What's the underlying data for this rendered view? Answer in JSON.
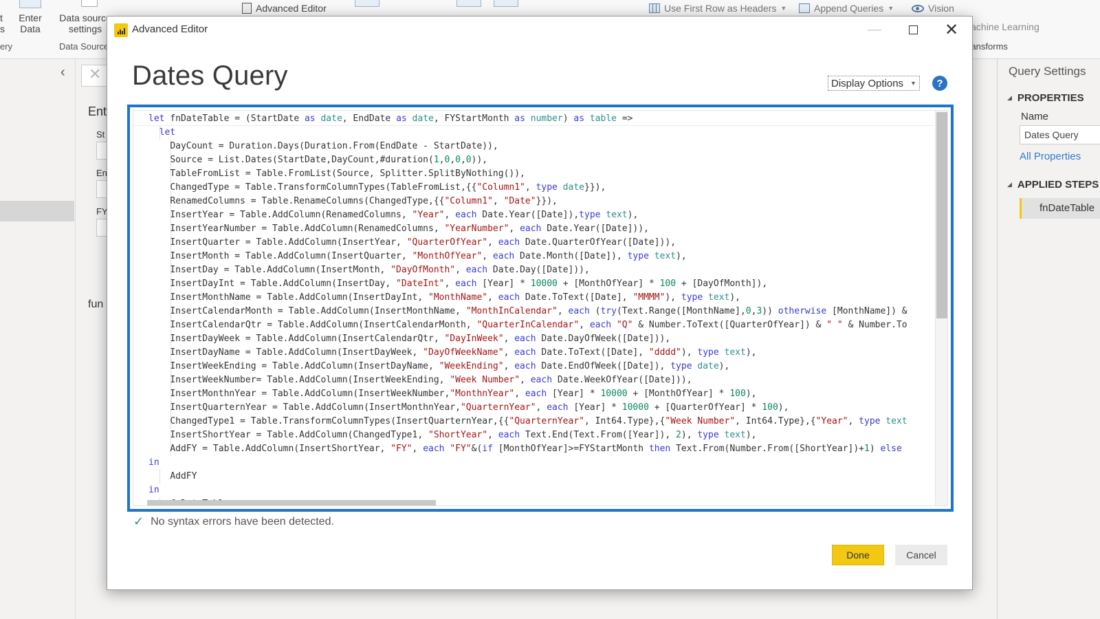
{
  "ribbon": {
    "partial_left_label": "t\ns",
    "enter_data": "Enter\nData",
    "data_source_settings": "Data source\nsettings",
    "group_query": "ery",
    "group_data_sources": "Data Sources",
    "advanced_editor": "Advanced Editor",
    "use_first_row": "Use First Row as Headers",
    "append_queries": "Append Queries",
    "vision": "Vision",
    "machine_learning": "Azure Machine Learning",
    "group_transforms": "AI Transforms"
  },
  "middle_pane": {
    "heading": "Ent",
    "param1": "St",
    "param2": "En",
    "param3": "FY",
    "func_label": "fun"
  },
  "settings": {
    "title": "Query Settings",
    "properties": "PROPERTIES",
    "name_label": "Name",
    "name_value": "Dates Query",
    "all_properties": "All Properties",
    "applied_steps": "APPLIED STEPS",
    "steps": [
      "fnDateTable"
    ]
  },
  "dialog": {
    "title": "Advanced Editor",
    "query_name": "Dates Query",
    "display_options": "Display Options",
    "help": "?",
    "status": "No syntax errors have been detected.",
    "done": "Done",
    "cancel": "Cancel",
    "code_lines": [
      {
        "indent": 0,
        "tokens": [
          [
            "kw",
            "let"
          ],
          [
            "",
            "fnDateTable = (StartDate "
          ],
          [
            "kw",
            "as"
          ],
          [
            "",
            ""
          ],
          [
            "ty",
            " date"
          ],
          [
            "",
            ", EndDate "
          ],
          [
            "kw",
            "as"
          ],
          [
            "ty",
            " date"
          ],
          [
            "",
            ", FYStartMonth "
          ],
          [
            "kw",
            "as"
          ],
          [
            "ty",
            " number"
          ],
          [
            "",
            ") "
          ],
          [
            "kw",
            "as"
          ],
          [
            "ty",
            " table"
          ],
          [
            "",
            " =>"
          ]
        ]
      },
      {
        "indent": 1,
        "tokens": [
          [
            "kw",
            "let"
          ]
        ]
      },
      {
        "indent": 2,
        "tokens": [
          [
            "",
            "DayCount = Duration.Days(Duration.From(EndDate - StartDate)),"
          ]
        ]
      },
      {
        "indent": 2,
        "tokens": [
          [
            "",
            "Source = List.Dates(StartDate,DayCount,#duration("
          ],
          [
            "nu",
            "1"
          ],
          [
            "",
            ","
          ],
          [
            "nu",
            "0"
          ],
          [
            "",
            ","
          ],
          [
            "nu",
            "0"
          ],
          [
            "",
            ","
          ],
          [
            "nu",
            "0"
          ],
          [
            "",
            ")),"
          ]
        ]
      },
      {
        "indent": 2,
        "tokens": [
          [
            "",
            "TableFromList = Table.FromList(Source, Splitter.SplitByNothing()),"
          ]
        ]
      },
      {
        "indent": 2,
        "tokens": [
          [
            "",
            "ChangedType = Table.TransformColumnTypes(TableFromList,{{"
          ],
          [
            "st",
            "\"Column1\""
          ],
          [
            "",
            ", "
          ],
          [
            "kw",
            "type"
          ],
          [
            "ty",
            " date"
          ],
          [
            "",
            "}}),"
          ]
        ]
      },
      {
        "indent": 2,
        "tokens": [
          [
            "",
            "RenamedColumns = Table.RenameColumns(ChangedType,{{"
          ],
          [
            "st",
            "\"Column1\""
          ],
          [
            "",
            ", "
          ],
          [
            "st",
            "\"Date\""
          ],
          [
            "",
            "}}),"
          ]
        ]
      },
      {
        "indent": 2,
        "tokens": [
          [
            "",
            "InsertYear = Table.AddColumn(RenamedColumns, "
          ],
          [
            "st",
            "\"Year\""
          ],
          [
            "",
            ", "
          ],
          [
            "kw",
            "each"
          ],
          [
            "",
            " Date.Year([Date]),"
          ],
          [
            "kw",
            "type"
          ],
          [
            "ty",
            " text"
          ],
          [
            "",
            "),"
          ]
        ]
      },
      {
        "indent": 2,
        "tokens": [
          [
            "",
            "InsertYearNumber = Table.AddColumn(RenamedColumns, "
          ],
          [
            "st",
            "\"YearNumber\""
          ],
          [
            "",
            ", "
          ],
          [
            "kw",
            "each"
          ],
          [
            "",
            " Date.Year([Date])),"
          ]
        ]
      },
      {
        "indent": 2,
        "tokens": [
          [
            "",
            "InsertQuarter = Table.AddColumn(InsertYear, "
          ],
          [
            "st",
            "\"QuarterOfYear\""
          ],
          [
            "",
            ", "
          ],
          [
            "kw",
            "each"
          ],
          [
            "",
            " Date.QuarterOfYear([Date])),"
          ]
        ]
      },
      {
        "indent": 2,
        "tokens": [
          [
            "",
            "InsertMonth = Table.AddColumn(InsertQuarter, "
          ],
          [
            "st",
            "\"MonthOfYear\""
          ],
          [
            "",
            ", "
          ],
          [
            "kw",
            "each"
          ],
          [
            "",
            " Date.Month([Date]), "
          ],
          [
            "kw",
            "type"
          ],
          [
            "ty",
            " text"
          ],
          [
            "",
            "),"
          ]
        ]
      },
      {
        "indent": 2,
        "tokens": [
          [
            "",
            "InsertDay = Table.AddColumn(InsertMonth, "
          ],
          [
            "st",
            "\"DayOfMonth\""
          ],
          [
            "",
            ", "
          ],
          [
            "kw",
            "each"
          ],
          [
            "",
            " Date.Day([Date])),"
          ]
        ]
      },
      {
        "indent": 2,
        "tokens": [
          [
            "",
            "InsertDayInt = Table.AddColumn(InsertDay, "
          ],
          [
            "st",
            "\"DateInt\""
          ],
          [
            "",
            ", "
          ],
          [
            "kw",
            "each"
          ],
          [
            "",
            " [Year] * "
          ],
          [
            "nu",
            "10000"
          ],
          [
            "",
            " + [MonthOfYear] * "
          ],
          [
            "nu",
            "100"
          ],
          [
            "",
            " + [DayOfMonth]),"
          ]
        ]
      },
      {
        "indent": 2,
        "tokens": [
          [
            "",
            "InsertMonthName = Table.AddColumn(InsertDayInt, "
          ],
          [
            "st",
            "\"MonthName\""
          ],
          [
            "",
            ", "
          ],
          [
            "kw",
            "each"
          ],
          [
            "",
            " Date.ToText([Date], "
          ],
          [
            "st",
            "\"MMMM\""
          ],
          [
            "",
            "), "
          ],
          [
            "kw",
            "type"
          ],
          [
            "ty",
            " text"
          ],
          [
            "",
            "),"
          ]
        ]
      },
      {
        "indent": 2,
        "tokens": [
          [
            "",
            "InsertCalendarMonth = Table.AddColumn(InsertMonthName, "
          ],
          [
            "st",
            "\"MonthInCalendar\""
          ],
          [
            "",
            ", "
          ],
          [
            "kw",
            "each"
          ],
          [
            "",
            " ("
          ],
          [
            "kw",
            "try"
          ],
          [
            "",
            "(Text.Range([MonthName],"
          ],
          [
            "nu",
            "0"
          ],
          [
            "",
            ","
          ],
          [
            "nu",
            "3"
          ],
          [
            "",
            ")) "
          ],
          [
            "kw",
            "otherwise"
          ],
          [
            "",
            " [MonthName]) &"
          ]
        ]
      },
      {
        "indent": 2,
        "tokens": [
          [
            "",
            "InsertCalendarQtr = Table.AddColumn(InsertCalendarMonth, "
          ],
          [
            "st",
            "\"QuarterInCalendar\""
          ],
          [
            "",
            ", "
          ],
          [
            "kw",
            "each"
          ],
          [
            "",
            " "
          ],
          [
            "st",
            "\"Q\""
          ],
          [
            "",
            " & Number.ToText([QuarterOfYear]) & "
          ],
          [
            "st",
            "\" \""
          ],
          [
            "",
            " & Number.To"
          ]
        ]
      },
      {
        "indent": 2,
        "tokens": [
          [
            "",
            "InsertDayWeek = Table.AddColumn(InsertCalendarQtr, "
          ],
          [
            "st",
            "\"DayInWeek\""
          ],
          [
            "",
            ", "
          ],
          [
            "kw",
            "each"
          ],
          [
            "",
            " Date.DayOfWeek([Date])),"
          ]
        ]
      },
      {
        "indent": 2,
        "tokens": [
          [
            "",
            "InsertDayName = Table.AddColumn(InsertDayWeek, "
          ],
          [
            "st",
            "\"DayOfWeekName\""
          ],
          [
            "",
            ", "
          ],
          [
            "kw",
            "each"
          ],
          [
            "",
            " Date.ToText([Date], "
          ],
          [
            "st",
            "\"dddd\""
          ],
          [
            "",
            "), "
          ],
          [
            "kw",
            "type"
          ],
          [
            "ty",
            " text"
          ],
          [
            "",
            "),"
          ]
        ]
      },
      {
        "indent": 2,
        "tokens": [
          [
            "",
            "InsertWeekEnding = Table.AddColumn(InsertDayName, "
          ],
          [
            "st",
            "\"WeekEnding\""
          ],
          [
            "",
            ", "
          ],
          [
            "kw",
            "each"
          ],
          [
            "",
            " Date.EndOfWeek([Date]), "
          ],
          [
            "kw",
            "type"
          ],
          [
            "ty",
            " date"
          ],
          [
            "",
            "),"
          ]
        ]
      },
      {
        "indent": 2,
        "tokens": [
          [
            "",
            "InsertWeekNumber= Table.AddColumn(InsertWeekEnding, "
          ],
          [
            "st",
            "\"Week Number\""
          ],
          [
            "",
            ", "
          ],
          [
            "kw",
            "each"
          ],
          [
            "",
            " Date.WeekOfYear([Date])),"
          ]
        ]
      },
      {
        "indent": 2,
        "tokens": [
          [
            "",
            "InsertMonthnYear = Table.AddColumn(InsertWeekNumber,"
          ],
          [
            "st",
            "\"MonthnYear\""
          ],
          [
            "",
            ", "
          ],
          [
            "kw",
            "each"
          ],
          [
            "",
            " [Year] * "
          ],
          [
            "nu",
            "10000"
          ],
          [
            "",
            " + [MonthOfYear] * "
          ],
          [
            "nu",
            "100"
          ],
          [
            "",
            "),"
          ]
        ]
      },
      {
        "indent": 2,
        "tokens": [
          [
            "",
            "InsertQuarternYear = Table.AddColumn(InsertMonthnYear,"
          ],
          [
            "st",
            "\"QuarternYear\""
          ],
          [
            "",
            ", "
          ],
          [
            "kw",
            "each"
          ],
          [
            "",
            " [Year] * "
          ],
          [
            "nu",
            "10000"
          ],
          [
            "",
            " + [QuarterOfYear] * "
          ],
          [
            "nu",
            "100"
          ],
          [
            "",
            "),"
          ]
        ]
      },
      {
        "indent": 2,
        "tokens": [
          [
            "",
            "ChangedType1 = Table.TransformColumnTypes(InsertQuarternYear,{{"
          ],
          [
            "st",
            "\"QuarternYear\""
          ],
          [
            "",
            ", Int64.Type},{"
          ],
          [
            "st",
            "\"Week Number\""
          ],
          [
            "",
            ", Int64.Type},{"
          ],
          [
            "st",
            "\"Year\""
          ],
          [
            "",
            ", "
          ],
          [
            "kw",
            "type"
          ],
          [
            "ty",
            " text"
          ]
        ]
      },
      {
        "indent": 2,
        "tokens": [
          [
            "",
            "InsertShortYear = Table.AddColumn(ChangedType1, "
          ],
          [
            "st",
            "\"ShortYear\""
          ],
          [
            "",
            ", "
          ],
          [
            "kw",
            "each"
          ],
          [
            "",
            " Text.End(Text.From([Year]), "
          ],
          [
            "nu",
            "2"
          ],
          [
            "",
            "), "
          ],
          [
            "kw",
            "type"
          ],
          [
            "ty",
            " text"
          ],
          [
            "",
            "),"
          ]
        ]
      },
      {
        "indent": 2,
        "tokens": [
          [
            "",
            "AddFY = Table.AddColumn(InsertShortYear, "
          ],
          [
            "st",
            "\"FY\""
          ],
          [
            "",
            ", "
          ],
          [
            "kw",
            "each"
          ],
          [
            "",
            " "
          ],
          [
            "st",
            "\"FY\""
          ],
          [
            "",
            "&("
          ],
          [
            "kw",
            "if"
          ],
          [
            "",
            " [MonthOfYear]>=FYStartMonth "
          ],
          [
            "kw",
            "then"
          ],
          [
            "",
            " Text.From(Number.From([ShortYear])+"
          ],
          [
            "nu",
            "1"
          ],
          [
            "",
            ") "
          ],
          [
            "kw",
            "else"
          ]
        ]
      },
      {
        "indent": 0,
        "tokens": [
          [
            "kw",
            "in"
          ]
        ]
      },
      {
        "indent": 2,
        "tokens": [
          [
            "",
            "AddFY"
          ]
        ]
      },
      {
        "indent": 0,
        "tokens": [
          [
            "kw",
            "in"
          ]
        ]
      },
      {
        "indent": 2,
        "tokens": [
          [
            "",
            "fnDateTable"
          ]
        ]
      }
    ]
  },
  "colors": {
    "accent_blue": "#1e73cc",
    "powerbi_yellow": "#f2c811",
    "keyword": "#3b3bd0",
    "type": "#2d8e8e",
    "string": "#a31515",
    "number": "#09885a"
  }
}
